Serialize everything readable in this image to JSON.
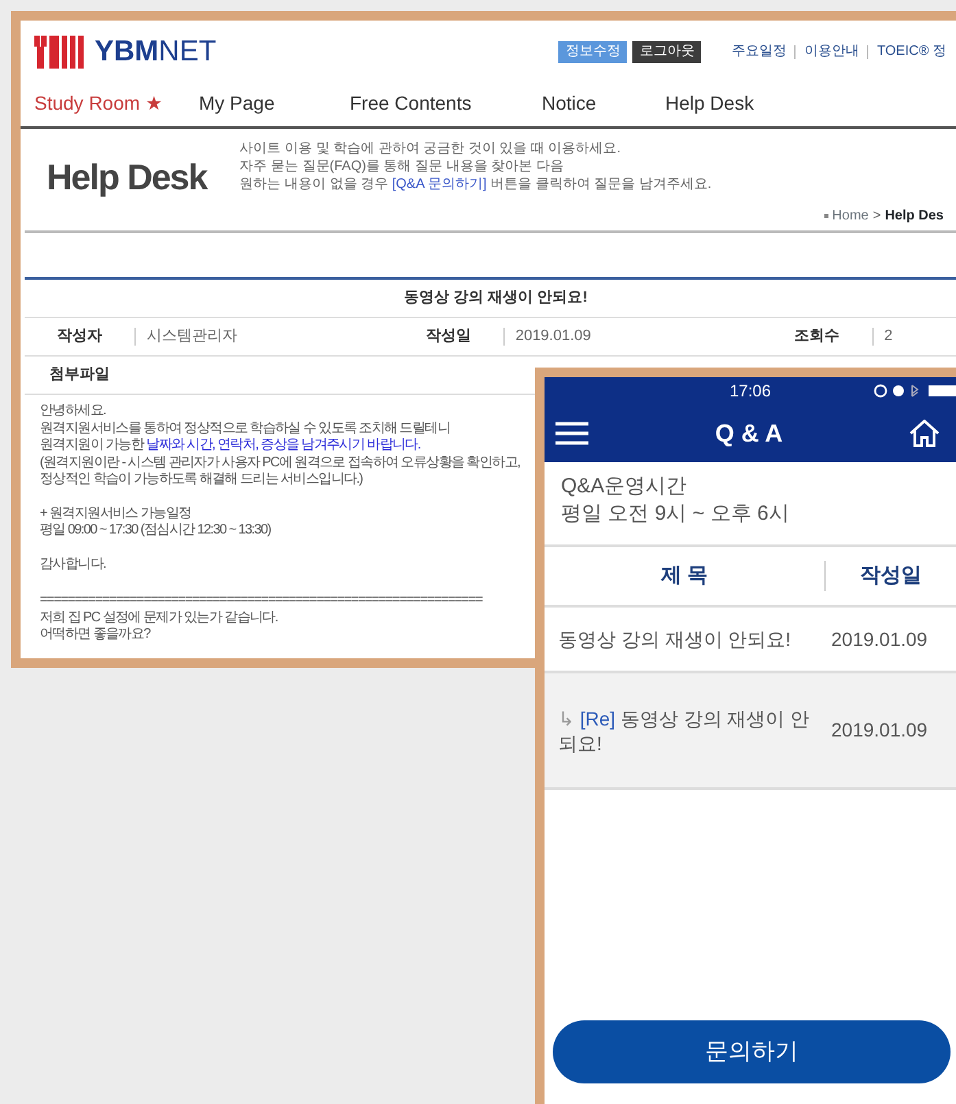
{
  "desktop": {
    "logo": {
      "bold": "YBM",
      "light": "NET"
    },
    "account_buttons": [
      {
        "label": "정보수정",
        "kind": "primary"
      },
      {
        "label": "로그아웃",
        "kind": "dark"
      }
    ],
    "top_links": [
      "주요일정",
      "이용안내",
      "TOEIC® 정"
    ],
    "nav": [
      {
        "label": "Study Room ★",
        "featured": true
      },
      {
        "label": "My Page",
        "featured": false
      },
      {
        "label": "Free Contents",
        "featured": false
      },
      {
        "label": "Notice",
        "featured": false
      },
      {
        "label": "Help Desk",
        "featured": false
      }
    ],
    "page_header": {
      "title": "Help Desk",
      "intro": [
        [
          {
            "text": "사이트 이용 및 학습에 관하여 궁금한 것이 있을 때 이용하세요.",
            "emphasis": false
          }
        ],
        [
          {
            "text": "자주 묻는 질문(FAQ)를 통해 질문 내용을 찾아본 다음",
            "emphasis": false
          }
        ],
        [
          {
            "text": "원하는 내용이 없을 경우 ",
            "emphasis": false
          },
          {
            "text": "[Q&A 문의하기]",
            "emphasis": true
          },
          {
            "text": " 버튼을 클릭하여 질문을 남겨주세요.",
            "emphasis": false
          }
        ]
      ],
      "breadcrumb": {
        "home": "Home",
        "separator": ">",
        "current": "Help Des"
      }
    },
    "post": {
      "title": "동영상 강의 재생이 안되요!",
      "meta": [
        {
          "label": "작성자",
          "value": "시스템관리자"
        },
        {
          "label": "작성일",
          "value": "2019.01.09"
        },
        {
          "label": "조회수",
          "value": "2"
        }
      ],
      "attachment_label": "첨부파일",
      "body": [
        [
          [
            {
              "text": "안녕하세요.",
              "emphasis": false
            }
          ],
          [
            {
              "text": "원격지원서비스를 통하여 정상적으로 학습하실 수 있도록 조치해 드릴테니",
              "emphasis": false
            }
          ],
          [
            {
              "text": "원격지원이 가능한 ",
              "emphasis": false
            },
            {
              "text": "날짜와 시간, 연락처, 증상을 남겨주시기 바랍니다.",
              "emphasis": true
            }
          ],
          [
            {
              "text": "(원격지원이란 - 시스템 관리자가 사용자 PC에 원격으로 접속하여 오류상황을 확인하고,",
              "emphasis": false
            }
          ],
          [
            {
              "text": "정상적인 학습이 가능하도록 해결해 드리는 서비스입니다.)",
              "emphasis": false
            }
          ]
        ],
        [
          [
            {
              "text": "+ 원격지원서비스 가능일정",
              "emphasis": false
            }
          ],
          [
            {
              "text": "평일 09:00 ~ 17:30 (점심시간 12:30 ~ 13:30)",
              "emphasis": false
            }
          ]
        ],
        [
          [
            {
              "text": "감사합니다.",
              "emphasis": false
            }
          ]
        ],
        [
          [
            {
              "text": "================================================================",
              "emphasis": false
            }
          ],
          [
            {
              "text": "저희 집 PC 설정에 문제가 있는가 같습니다.",
              "emphasis": false
            }
          ],
          [
            {
              "text": "어떡하면 좋을까요?",
              "emphasis": false
            }
          ]
        ]
      ]
    }
  },
  "phone": {
    "status_time": "17:06",
    "title": "Q & A",
    "info": [
      "Q&A운영시간",
      "평일 오전 9시 ~ 오후 6시"
    ],
    "columns": [
      "제 목",
      "작성일"
    ],
    "rows": [
      {
        "reply": false,
        "title": "동영상 강의 재생이 안되요!",
        "date": "2019.01.09"
      },
      {
        "reply": true,
        "marker": "↳",
        "tag": "[Re]",
        "title": "동영상 강의 재생이 안되요!",
        "date": "2019.01.09"
      }
    ],
    "button": "문의하기"
  }
}
